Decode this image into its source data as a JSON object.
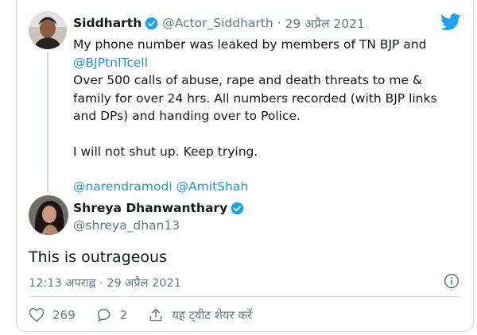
{
  "parent_tweet": {
    "author_name": "Siddharth",
    "handle": "@Actor_Siddharth",
    "separator": "·",
    "date": "29 अप्रैल 2021",
    "text_line1": "My phone number was leaked by members of TN BJP and",
    "mention_bjp": "@BJPtnITcell",
    "text_para2": "Over 500 calls of abuse, rape and death threats to me & family for over 24 hrs. All numbers recorded (with BJP links and DPs) and handing over to Police.",
    "text_para3": "I will not shut up. Keep trying.",
    "mention_modi": "@narendramodi",
    "mention_shah": "@AmitShah"
  },
  "reply_tweet": {
    "author_name": "Shreya Dhanwanthary",
    "handle": "@shreya_dhan13",
    "text": "This is outrageous",
    "timestamp": "12:13 अपराह्न · 29 अप्रैल 2021"
  },
  "actions": {
    "like_count": "269",
    "reply_count": "2",
    "share_label": "यह ट्वीट शेयर करें"
  },
  "colors": {
    "brand_blue": "#1da1f2",
    "link_blue": "#1b95e0",
    "text_primary": "#14171a",
    "text_muted": "#657786",
    "border": "#cfd9de"
  },
  "icons": [
    "verified-badge-icon",
    "twitter-bird-icon",
    "info-icon",
    "heart-icon",
    "reply-bubble-icon",
    "share-icon"
  ]
}
